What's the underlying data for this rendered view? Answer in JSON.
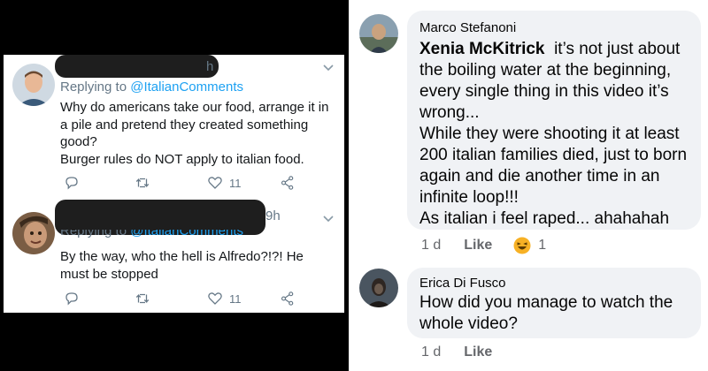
{
  "twitter": {
    "tweets": [
      {
        "time_fragment": "h",
        "replying_prefix": "Replying to ",
        "replying_handle": "@ItalianComments",
        "text_lines": [
          "Why do americans take our food, arrange it in",
          "a pile and pretend they created something",
          "good?",
          "Burger rules do NOT apply to italian food."
        ],
        "like_count": "11"
      },
      {
        "time_fragment": "9h",
        "replying_prefix": "Replying to ",
        "replying_handle": "@ItalianComments",
        "text_lines": [
          "By the way, who the hell is Alfredo?!?! He",
          "must be stopped"
        ],
        "like_count": "11"
      }
    ],
    "icons": [
      "reply-icon",
      "retweet-icon",
      "heart-icon",
      "share-icon",
      "chevron-down-icon"
    ],
    "colors": {
      "mention": "#1da1f2",
      "muted": "#657786"
    }
  },
  "facebook": {
    "comments": [
      {
        "author": "Marco Stefanoni",
        "tagged": "Xenia McKitrick",
        "text_lines": [
          "it’s not just about",
          "the boiling water at the beginning,",
          "every single thing in this video it’s",
          "wrong...",
          "While they were shooting it at least",
          "200 italian families died, just to born",
          "again and die another time in an",
          "infinite loop!!!",
          "As italian i feel raped... ahahahah"
        ],
        "time": "1 d",
        "like_label": "Like",
        "reaction_count": "1"
      },
      {
        "author": "Erica Di Fusco",
        "text_lines": [
          "How did you manage to watch the",
          "whole video?"
        ],
        "time": "1 d",
        "like_label": "Like"
      }
    ],
    "icons": [
      "laughing-reaction-icon"
    ],
    "colors": {
      "bubble": "#f0f2f5",
      "muted": "#65676b",
      "reaction": "#f7b125"
    }
  }
}
